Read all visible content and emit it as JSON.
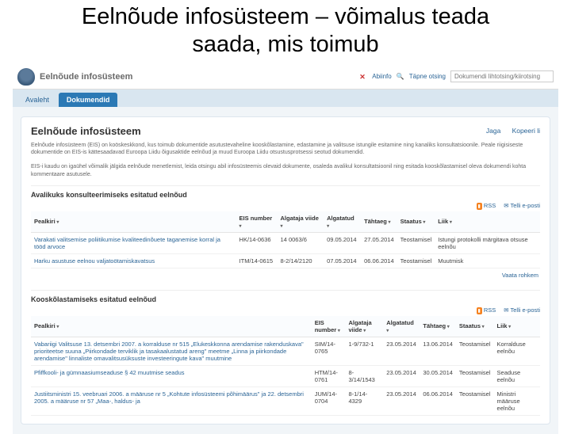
{
  "slide": {
    "title": "Eelnõude infosüsteem – võimalus teada saada, mis toimub"
  },
  "topbar": {
    "app_name": "Eelnõude infosüsteem",
    "alert_label": "Abiinfo",
    "advanced_label": "Täpne otsing",
    "search_placeholder": "Dokumendi lihtotsing/kiirotsing"
  },
  "tabs": {
    "home": "Avaleht",
    "docs": "Dokumendid"
  },
  "panel": {
    "title": "Eelnõude infosüsteem",
    "share": "Jaga",
    "copy": "Kopeeri li",
    "lead1": "Eelnõude infosüsteem (EIS) on koöskeskkond, kus toimub dokumentide asutustevaheline kooskõlastamine, edastamine ja valitsuse istungile esitamine ning kanaliks konsultatsioonile. Peale riigisiseste dokumentide on EIS-is kättesaadavad Euroopa Liidu õigusaktide eelnõud ja muud Euroopa Liidu otsustusprotsessi seotud dokumendid.",
    "lead2": "EIS-i kaudu on igaühel võimalik jälgida eelnõude menetlemist, leida otsingu abil infosüsteemis olevaid dokumente, osaleda avalikul konsultatsioonil ning esitada kooskõlastamisel oleva dokumendi kohta kommentaare asutusele."
  },
  "feeds": {
    "rss": "RSS",
    "subscribe": "Telli e-posti"
  },
  "sec1": {
    "title": "Avalikuks konsulteerimiseks esitatud eelnõud",
    "headers": [
      "Pealkiri",
      "EIS number",
      "Algataja viide",
      "Algatatud",
      "Tähtaeg",
      "Staatus",
      "Liik"
    ],
    "rows": [
      {
        "title": "Varakati valitsemise poliitikumise kvaliteedinõuete taganemise korral ja tööd arvoce",
        "eis": "HK/14-0636",
        "viide": "14 0063/6",
        "alg": "09.05.2014",
        "taht": "27.05.2014",
        "staatus": "Teostamisel",
        "liik": "Istungi protokolli märgitava otsuse eelnõu"
      },
      {
        "title": "Harku asustuse eelnou valjatoötamiskavatsus",
        "eis": "ITM/14-0615",
        "viide": "8-2/14/2120",
        "alg": "07.05.2014",
        "taht": "06.06.2014",
        "staatus": "Teostamisel",
        "liik": "Muutmisk"
      }
    ],
    "more": "Vaata rohkem"
  },
  "sec2": {
    "title": "Kooskõlastamiseks esitatud eelnõud",
    "headers": [
      "Pealkiri",
      "EIS number",
      "Algataja viide",
      "Algatatud",
      "Tähtaeg",
      "Staatus",
      "Liik"
    ],
    "rows": [
      {
        "title": "Vabariigi Valitsuse 13. detsembri 2007. a korralduse nr 515 „Elukeskkonna arendamise rakenduskava\" prioriteetse suuna „Piirkondade terviklik ja tasakaalustatud areng\" meetme „Linna ja piirkondade arendamise\" linnaliste omavalitsusüksuste investeeringute kava\" muutmine",
        "eis": "SIM/14-0765",
        "viide": "1-9/732-1",
        "alg": "23.05.2014",
        "taht": "13.06.2014",
        "staatus": "Teostamisel",
        "liik": "Korralduse eelnõu"
      },
      {
        "title": "Pfiffkooli- ja gümnaasiumseaduse § 42 muutmise seadus",
        "eis": "HTM/14-0761",
        "viide": "8-3/14/1543",
        "alg": "23.05.2014",
        "taht": "30.05.2014",
        "staatus": "Teostamisel",
        "liik": "Seaduse eelnõu"
      },
      {
        "title": "Justiitsministri 15. veebruari 2006. a määruse nr 5 „Kohtute infosüsteemi põhimäärus\" ja 22. detsembri 2005. a määruse nr 57 „Maa-, haldus- ja",
        "eis": "JUM/14-0704",
        "viide": "8-1/14-4329",
        "alg": "23.05.2014",
        "taht": "06.06.2014",
        "staatus": "Teostamisel",
        "liik": "Ministri määruse eelnõu"
      }
    ]
  }
}
